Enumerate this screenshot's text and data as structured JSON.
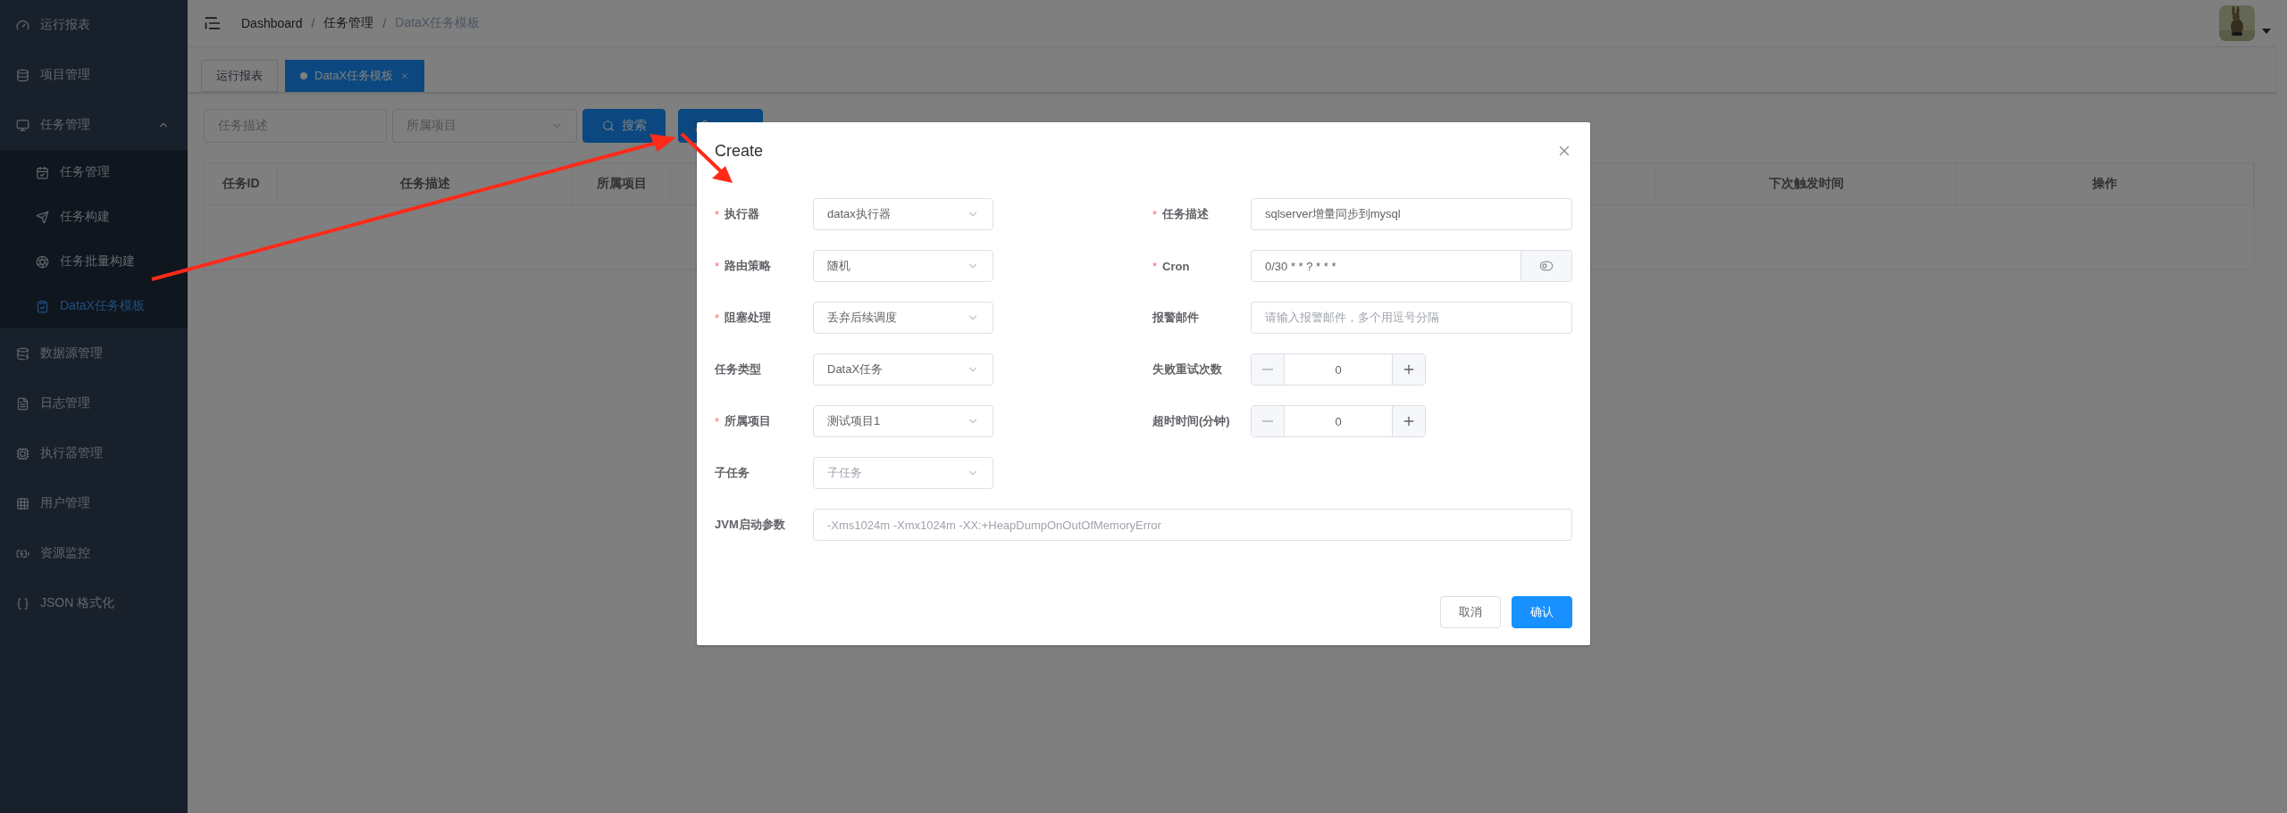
{
  "sidebar": {
    "items": [
      {
        "label": "运行报表",
        "selected": false
      },
      {
        "label": "项目管理",
        "selected": false
      },
      {
        "label": "任务管理",
        "selected": false,
        "expanded": true,
        "children": [
          {
            "label": "任务管理",
            "selected": false
          },
          {
            "label": "任务构建",
            "selected": false
          },
          {
            "label": "任务批量构建",
            "selected": false
          },
          {
            "label": "DataX任务模板",
            "selected": true
          }
        ]
      },
      {
        "label": "数据源管理",
        "selected": false
      },
      {
        "label": "日志管理",
        "selected": false
      },
      {
        "label": "执行器管理",
        "selected": false
      },
      {
        "label": "用户管理",
        "selected": false
      },
      {
        "label": "资源监控",
        "selected": false
      },
      {
        "label": "JSON 格式化",
        "selected": false
      }
    ]
  },
  "header": {
    "breadcrumb": [
      "Dashboard",
      "任务管理",
      "DataX任务模板"
    ],
    "breadcrumb_separators": [
      "/",
      "/"
    ]
  },
  "tags": [
    {
      "label": "运行报表",
      "selected": false
    },
    {
      "label": "DataX任务模板",
      "selected": true
    }
  ],
  "filters": {
    "description_placeholder": "任务描述",
    "project_placeholder": "所属项目",
    "search_button": "搜索"
  },
  "table": {
    "columns_left": [
      "任务ID",
      "任务描述",
      "所属项目"
    ],
    "columns_right": [
      "下次触发时间",
      "操作"
    ]
  },
  "dialog": {
    "title": "Create",
    "left_fields": [
      {
        "label": "执行器",
        "required_mark": "*",
        "kind": "select",
        "value": "datax执行器"
      },
      {
        "label": "路由策略",
        "required_mark": "*",
        "kind": "select",
        "value": "随机"
      },
      {
        "label": "阻塞处理",
        "required_mark": "*",
        "kind": "select",
        "value": "丢弃后续调度"
      },
      {
        "label": "任务类型",
        "kind": "select",
        "value": "DataX任务"
      },
      {
        "label": "所属项目",
        "required_mark": "*",
        "kind": "select",
        "value": "测试项目1"
      },
      {
        "label": "子任务",
        "kind": "select",
        "placeholder": "子任务"
      }
    ],
    "right_fields": [
      {
        "label": "任务描述",
        "required_mark": "*",
        "kind": "input",
        "value": "sqlserver增量同步到mysql"
      },
      {
        "label": "Cron",
        "required_mark": "*",
        "kind": "cron",
        "value": "0/30 * * ? * * *"
      },
      {
        "label": "报警邮件",
        "kind": "input",
        "placeholder": "请输入报警邮件，多个用逗号分隔"
      },
      {
        "label": "失败重试次数",
        "kind": "number",
        "value": "0",
        "decrease_disabled": true
      },
      {
        "label": "超时时间(分钟)",
        "kind": "number",
        "value": "0",
        "decrease_disabled": true
      }
    ],
    "jvm": {
      "label": "JVM启动参数",
      "placeholder": "-Xms1024m -Xmx1024m -XX:+HeapDumpOnOutOfMemoryError"
    },
    "buttons": [
      {
        "label": "取消",
        "kind": "default"
      },
      {
        "label": "确认",
        "kind": "primary"
      }
    ]
  }
}
